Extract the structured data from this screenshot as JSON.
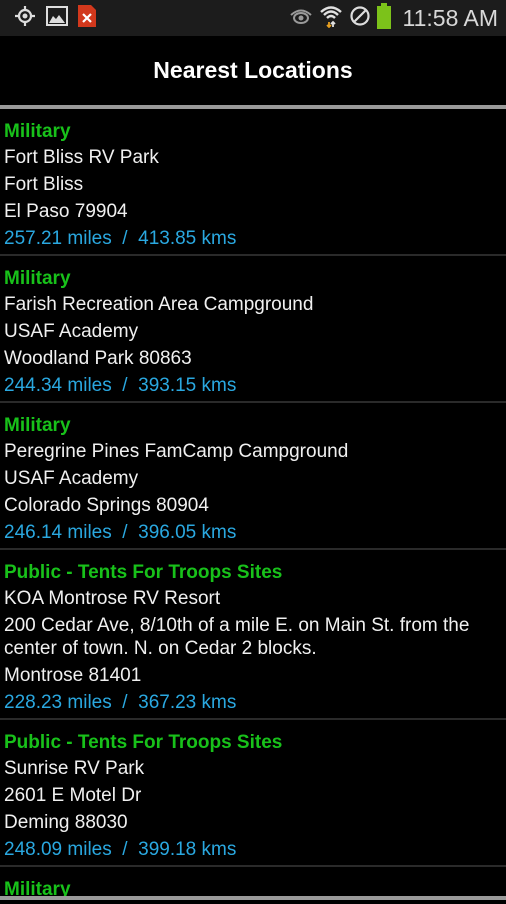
{
  "status_bar": {
    "left_icons": [
      "gps-icon",
      "image-icon",
      "app-notification-icon"
    ],
    "right_icons": [
      "eye-icon",
      "wifi-icon",
      "blocked-icon",
      "battery-icon"
    ],
    "time": "11:58 AM"
  },
  "header": {
    "title": "Nearest Locations"
  },
  "colors": {
    "category": "#18c11a",
    "distance": "#2aa8e0",
    "text": "#f0f0f0",
    "background": "#000000"
  },
  "locations": [
    {
      "category": "Military",
      "name": "Fort Bliss RV Park",
      "address": "Fort Bliss",
      "city": "El Paso 79904",
      "miles": "257.21 miles",
      "kms": "413.85 kms"
    },
    {
      "category": "Military",
      "name": "Farish Recreation Area Campground",
      "address": "USAF Academy",
      "city": "Woodland Park 80863",
      "miles": "244.34 miles",
      "kms": "393.15 kms"
    },
    {
      "category": "Military",
      "name": "Peregrine Pines FamCamp Campground",
      "address": "USAF Academy",
      "city": "Colorado Springs 80904",
      "miles": "246.14 miles",
      "kms": "396.05 kms"
    },
    {
      "category": "Public - Tents For Troops Sites",
      "name": "KOA Montrose RV Resort",
      "address": "200 Cedar Ave, 8/10th of a mile E. on Main St. from the center of town. N. on Cedar 2 blocks.",
      "city": "Montrose 81401",
      "miles": "228.23 miles",
      "kms": "367.23 kms"
    },
    {
      "category": "Public - Tents For Troops Sites",
      "name": "Sunrise RV Park",
      "address": "2601 E Motel Dr",
      "city": "Deming 88030",
      "miles": "248.09 miles",
      "kms": "399.18 kms"
    },
    {
      "category": "Military"
    }
  ],
  "distance_separator": "  /  "
}
